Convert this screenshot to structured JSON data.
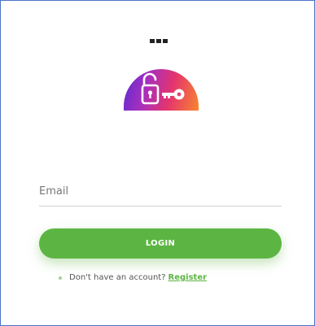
{
  "header": {
    "menu_icon": "ellipsis-icon"
  },
  "logo": {
    "icon": "unlocked-padlock-key-icon",
    "gradient": [
      "#5b2ad0",
      "#a52fc0",
      "#e4346f",
      "#f9862c"
    ]
  },
  "form": {
    "email_placeholder": "Email",
    "email_value": "",
    "login_label": "LOGIN"
  },
  "footer": {
    "prompt": "Don't have an account?",
    "register_label": "Register"
  },
  "colors": {
    "accent": "#5cb543",
    "border": "#4a74c9"
  }
}
